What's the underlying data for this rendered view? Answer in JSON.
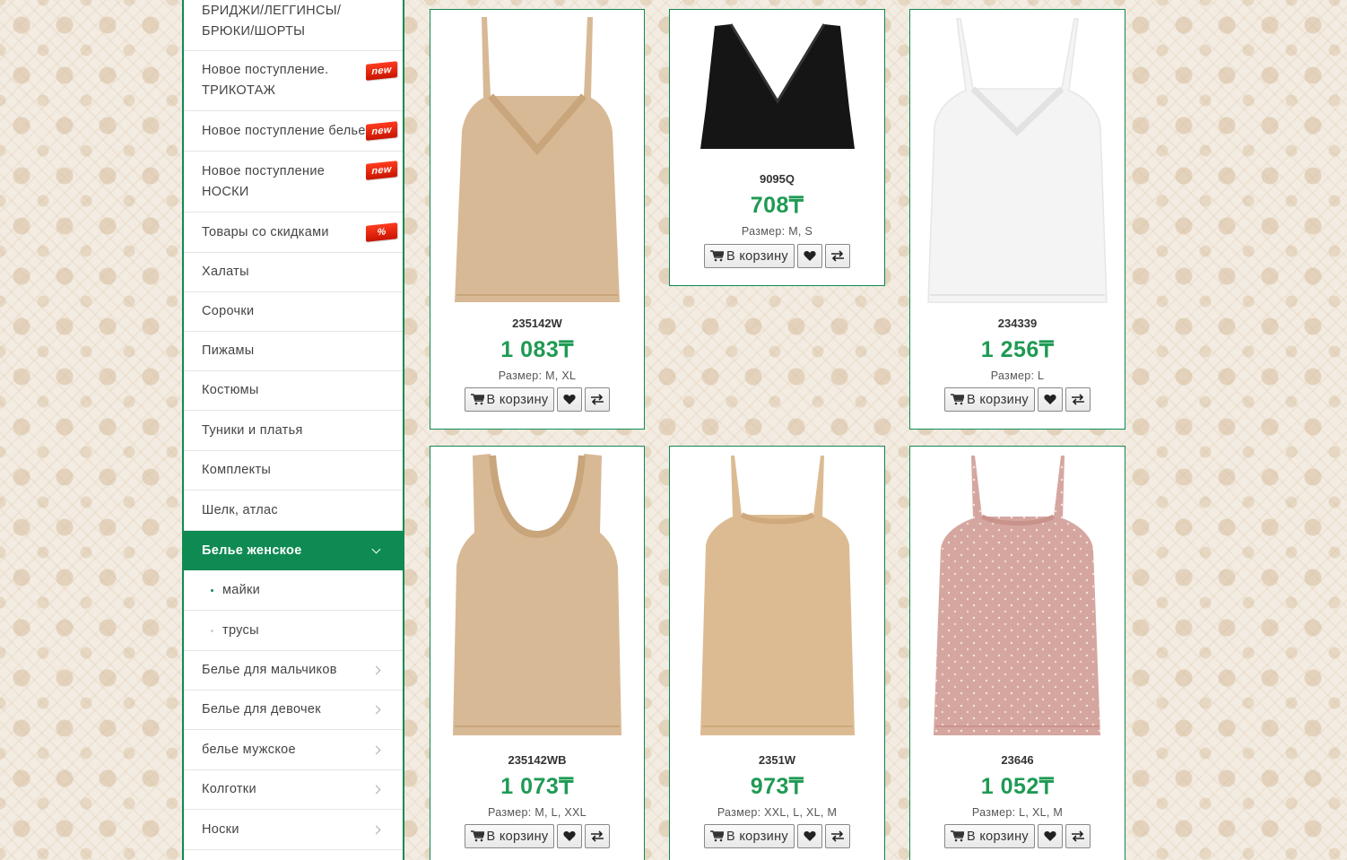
{
  "sidebar": {
    "items": [
      {
        "label": "БРИДЖИ/ЛЕГГИНСЫ/ БРЮКИ/ШОРТЫ"
      },
      {
        "label": "Новое поступление. ТРИКОТАЖ",
        "badge": "new"
      },
      {
        "label": "Новое поступление белье",
        "badge": "new"
      },
      {
        "label": "Новое поступление НОСКИ",
        "badge": "new"
      },
      {
        "label": "Товары со скидками",
        "badge": "%"
      },
      {
        "label": "Халаты"
      },
      {
        "label": "Сорочки"
      },
      {
        "label": "Пижамы"
      },
      {
        "label": "Костюмы"
      },
      {
        "label": "Туники и платья"
      },
      {
        "label": "Комплекты"
      },
      {
        "label": "Шелк, атлас"
      },
      {
        "label": "Белье женское"
      },
      {
        "label": "майки"
      },
      {
        "label": "трусы"
      },
      {
        "label": "Белье для мальчиков"
      },
      {
        "label": "Белье для девочек"
      },
      {
        "label": "белье мужское"
      },
      {
        "label": "Колготки"
      },
      {
        "label": "Носки"
      }
    ]
  },
  "products": [
    {
      "sku": "235142W",
      "price": "1 083₸",
      "sizes": "Размер:  M, XL",
      "color": "#d8b995"
    },
    {
      "sku": "9095Q",
      "price": "708₸",
      "sizes": "Размер:  M, S",
      "color": "#151515"
    },
    {
      "sku": "234339",
      "price": "1 256₸",
      "sizes": "Размер:  L",
      "color": "#f6f6f6"
    },
    {
      "sku": "235142WB",
      "price": "1 073₸",
      "sizes": "Размер:  M, L, XXL",
      "color": "#d8b995"
    },
    {
      "sku": "2351W",
      "price": "973₸",
      "sizes": "Размер:  XXL, L, XL, M",
      "color": "#dcbb93"
    },
    {
      "sku": "23646",
      "price": "1 052₸",
      "sizes": "Размер:  L, XL, M",
      "color": "#d5a6a0"
    }
  ],
  "buttons": {
    "cart": "В корзину"
  },
  "icons": {
    "cart": "cart-icon",
    "wishlist": "heart-icon",
    "compare": "compare-arrows-icon"
  },
  "colors": {
    "accent": "#0e8a52",
    "price": "#1e9a53",
    "badge": "#e0200a"
  }
}
